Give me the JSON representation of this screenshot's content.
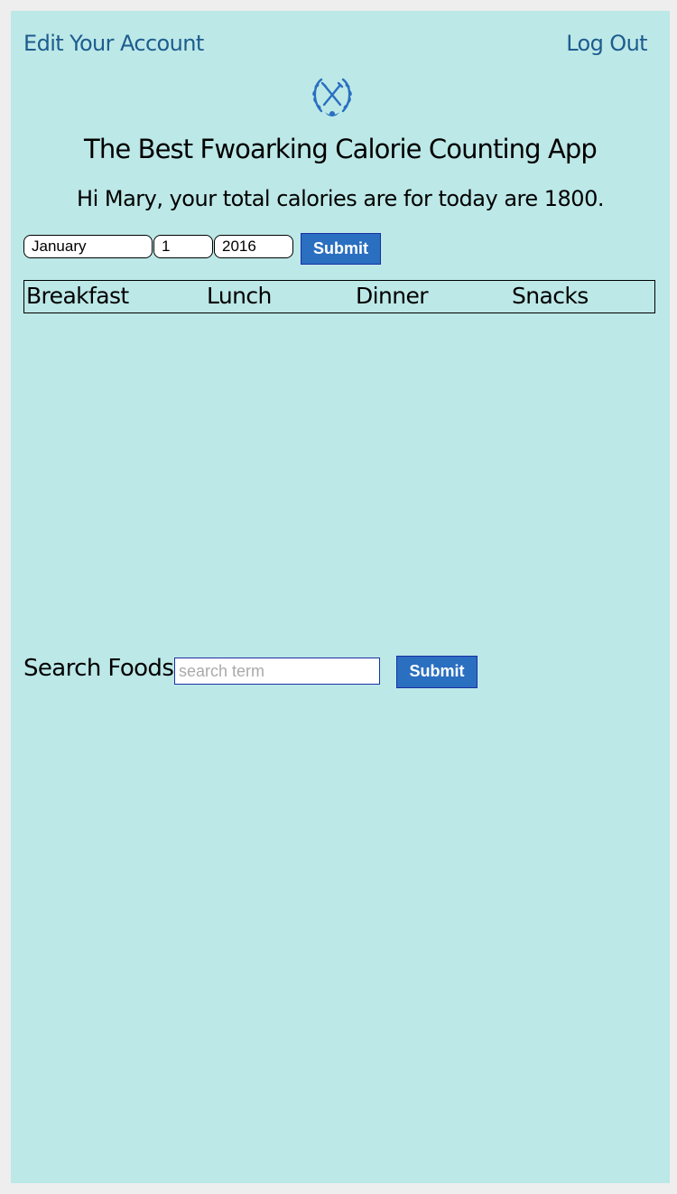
{
  "nav": {
    "edit_account": "Edit Your Account",
    "logout": "Log Out"
  },
  "logo": {
    "icon": "crossed-fork-knife-laurel-icon",
    "color": "#2a6fc0"
  },
  "header": {
    "title": "The Best Fwoarking Calorie Counting App",
    "greeting": "Hi Mary, your total calories are for today are 1800."
  },
  "date_form": {
    "month": "January",
    "day": "1",
    "year": "2016",
    "submit_label": "Submit"
  },
  "meals": [
    "Breakfast",
    "Lunch",
    "Dinner",
    "Snacks"
  ],
  "search": {
    "label": "Search Foods",
    "placeholder": "search term",
    "value": "",
    "submit_label": "Submit"
  },
  "colors": {
    "background": "#bce8e7",
    "link": "#1d5c8e",
    "button": "#2a6fc0"
  }
}
